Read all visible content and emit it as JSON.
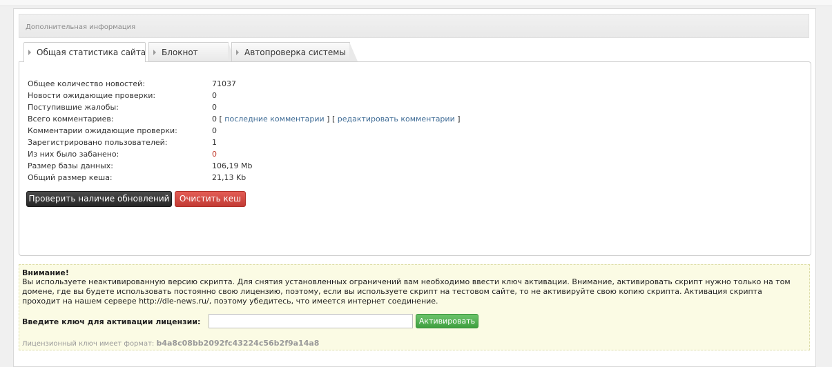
{
  "header": {
    "title": "Дополнительная информация"
  },
  "tabs": [
    {
      "label": "Общая статистика сайта",
      "active": true
    },
    {
      "label": "Блокнот",
      "active": false
    },
    {
      "label": "Автопроверка системы",
      "active": false
    }
  ],
  "stats": {
    "news_total": {
      "label": "Общее количество новостей:",
      "value": "71037"
    },
    "news_pending": {
      "label": "Новости ожидающие проверки:",
      "value": "0"
    },
    "complaints": {
      "label": "Поступившие жалобы:",
      "value": "0"
    },
    "comments_total": {
      "label": "Всего комментариев:",
      "value": "0",
      "bracket_open": "[",
      "bracket_close": "]",
      "link_last": "последние комментарии",
      "link_edit": "редактировать комментарии"
    },
    "comments_pending": {
      "label": "Комментарии ожидающие проверки:",
      "value": "0"
    },
    "users_registered": {
      "label": "Зарегистрировано пользователей:",
      "value": "1"
    },
    "users_banned": {
      "label": "Из них было забанено:",
      "value": "0"
    },
    "db_size": {
      "label": "Размер базы данных:",
      "value": "106,19 Mb"
    },
    "cache_size": {
      "label": "Общий размер кеша:",
      "value": "21,13 Kb"
    }
  },
  "buttons": {
    "check_updates": "Проверить наличие обновлений",
    "clear_cache": "Очистить кеш"
  },
  "warning": {
    "title": "Внимание!",
    "text": "Вы используете неактивированную версию скрипта. Для снятия установленных ограничений вам необходимо ввести ключ активации. Внимание, активировать скрипт нужно только на том домене, где вы будете использовать постоянно свою лицензию, поэтому, если вы используете скрипт на тестовом сайте, то не активируйте свою копию скрипта. Активация скрипта проходит на нашем сервере http://dle-news.ru/, поэтому убедитесь, что имеется интернет соединение.",
    "key_label": "Введите ключ для активации лицензии:",
    "key_value": "",
    "activate_button": "Активировать",
    "format_label": "Лицензионный ключ имеет формат:",
    "format_example": "b4a8c08bb2092fc43224c56b2f9a14a8"
  },
  "colors": {
    "danger": "#c0392b",
    "link": "#3e6b95",
    "success": "#3f9f3f"
  }
}
